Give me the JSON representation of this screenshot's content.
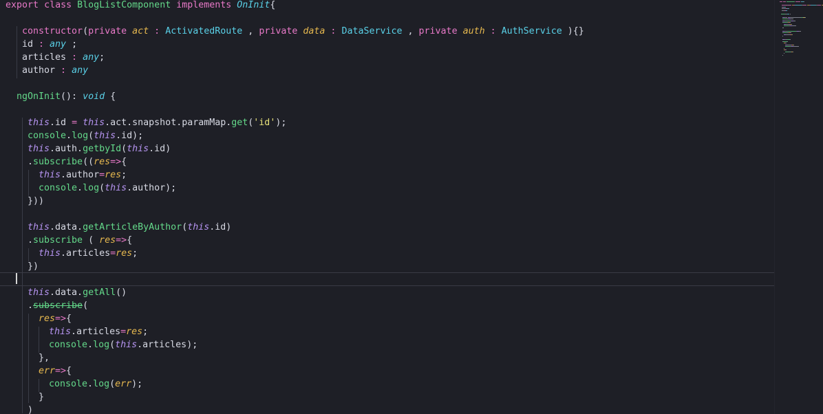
{
  "editor": {
    "lines": [
      {
        "indent": 8,
        "tokens": [
          [
            "export",
            "kw"
          ],
          [
            " ",
            "plain"
          ],
          [
            "class",
            "kw"
          ],
          [
            " ",
            "plain"
          ],
          [
            "BlogListComponent",
            "fn"
          ],
          [
            " ",
            "plain"
          ],
          [
            "implements",
            "kw"
          ],
          [
            " ",
            "plain"
          ],
          [
            "OnInit",
            "typei"
          ],
          [
            "{",
            "pun"
          ]
        ]
      },
      {
        "indent": 8,
        "tokens": []
      },
      {
        "indent": 32,
        "tokens": [
          [
            "constructor",
            "kw"
          ],
          [
            "(",
            "pun"
          ],
          [
            "private",
            "kw"
          ],
          [
            " ",
            "plain"
          ],
          [
            "act",
            "var"
          ],
          [
            " : ",
            "op"
          ],
          [
            "ActivatedRoute",
            "type"
          ],
          [
            " , ",
            "pun"
          ],
          [
            "private",
            "kw"
          ],
          [
            " ",
            "plain"
          ],
          [
            "data",
            "var"
          ],
          [
            " : ",
            "op"
          ],
          [
            "DataService",
            "type"
          ],
          [
            " , ",
            "pun"
          ],
          [
            "private",
            "kw"
          ],
          [
            " ",
            "plain"
          ],
          [
            "auth",
            "var"
          ],
          [
            " : ",
            "op"
          ],
          [
            "AuthService",
            "type"
          ],
          [
            " ){}",
            "pun"
          ]
        ]
      },
      {
        "indent": 32,
        "tokens": [
          [
            "id",
            "plain"
          ],
          [
            " : ",
            "op"
          ],
          [
            "any",
            "typei"
          ],
          [
            " ;",
            "pun"
          ]
        ]
      },
      {
        "indent": 32,
        "tokens": [
          [
            "articles",
            "plain"
          ],
          [
            " : ",
            "op"
          ],
          [
            "any",
            "typei"
          ],
          [
            ";",
            "pun"
          ]
        ]
      },
      {
        "indent": 32,
        "tokens": [
          [
            "author",
            "plain"
          ],
          [
            " : ",
            "op"
          ],
          [
            "any",
            "typei"
          ]
        ]
      },
      {
        "indent": 32,
        "tokens": []
      },
      {
        "indent": 24,
        "tokens": [
          [
            "ngOnInit",
            "fn"
          ],
          [
            "(): ",
            "pun"
          ],
          [
            "void",
            "typei"
          ],
          [
            " ",
            "plain"
          ],
          [
            "{",
            "brk"
          ]
        ]
      },
      {
        "indent": 24,
        "tokens": []
      },
      {
        "indent": 40,
        "tokens": [
          [
            "this",
            "this"
          ],
          [
            ".id ",
            "plain"
          ],
          [
            "=",
            "op"
          ],
          [
            " ",
            "plain"
          ],
          [
            "this",
            "this"
          ],
          [
            ".act.snapshot.paramMap.",
            "plain"
          ],
          [
            "get",
            "fn"
          ],
          [
            "(",
            "pun"
          ],
          [
            "'id'",
            "str"
          ],
          [
            ");",
            "pun"
          ]
        ]
      },
      {
        "indent": 40,
        "tokens": [
          [
            "console",
            "fn"
          ],
          [
            ".",
            "plain"
          ],
          [
            "log",
            "fn"
          ],
          [
            "(",
            "pun"
          ],
          [
            "this",
            "this"
          ],
          [
            ".id);",
            "plain"
          ]
        ]
      },
      {
        "indent": 40,
        "tokens": [
          [
            "this",
            "this"
          ],
          [
            ".auth.",
            "plain"
          ],
          [
            "getbyId",
            "fn"
          ],
          [
            "(",
            "pun"
          ],
          [
            "this",
            "this"
          ],
          [
            ".id)",
            "plain"
          ]
        ]
      },
      {
        "indent": 40,
        "tokens": [
          [
            ".",
            "plain"
          ],
          [
            "subscribe",
            "fn"
          ],
          [
            "((",
            "pun"
          ],
          [
            "res",
            "var"
          ],
          [
            "=>",
            "op"
          ],
          [
            "{",
            "pun"
          ]
        ]
      },
      {
        "indent": 56,
        "tokens": [
          [
            "this",
            "this"
          ],
          [
            ".author",
            "plain"
          ],
          [
            "=",
            "op"
          ],
          [
            "res",
            "var"
          ],
          [
            ";",
            "pun"
          ]
        ]
      },
      {
        "indent": 56,
        "tokens": [
          [
            "console",
            "fn"
          ],
          [
            ".",
            "plain"
          ],
          [
            "log",
            "fn"
          ],
          [
            "(",
            "pun"
          ],
          [
            "this",
            "this"
          ],
          [
            ".author);",
            "plain"
          ]
        ]
      },
      {
        "indent": 40,
        "tokens": [
          [
            "}))",
            "pun"
          ]
        ]
      },
      {
        "indent": 40,
        "tokens": []
      },
      {
        "indent": 40,
        "tokens": [
          [
            "this",
            "this"
          ],
          [
            ".data.",
            "plain"
          ],
          [
            "getArticleByAuthor",
            "fn"
          ],
          [
            "(",
            "pun"
          ],
          [
            "this",
            "this"
          ],
          [
            ".id)",
            "plain"
          ]
        ]
      },
      {
        "indent": 40,
        "tokens": [
          [
            ".",
            "plain"
          ],
          [
            "subscribe",
            "fn"
          ],
          [
            " ( ",
            "pun"
          ],
          [
            "res",
            "var"
          ],
          [
            "=>",
            "op"
          ],
          [
            "{",
            "pun"
          ]
        ]
      },
      {
        "indent": 56,
        "tokens": [
          [
            "this",
            "this"
          ],
          [
            ".articles",
            "plain"
          ],
          [
            "=",
            "op"
          ],
          [
            "res",
            "var"
          ],
          [
            ";",
            "pun"
          ]
        ]
      },
      {
        "indent": 40,
        "tokens": [
          [
            "})",
            "pun"
          ]
        ]
      },
      {
        "indent": 40,
        "tokens": []
      },
      {
        "indent": 40,
        "tokens": [
          [
            "this",
            "this"
          ],
          [
            ".data.",
            "plain"
          ],
          [
            "getAll",
            "fn"
          ],
          [
            "()",
            "pun"
          ]
        ]
      },
      {
        "indent": 40,
        "tokens": [
          [
            ".",
            "plain"
          ],
          [
            "subscribe",
            "strike"
          ],
          [
            "(",
            "pun"
          ]
        ]
      },
      {
        "indent": 56,
        "tokens": [
          [
            "res",
            "var"
          ],
          [
            "=>",
            "op"
          ],
          [
            "{",
            "pun"
          ]
        ]
      },
      {
        "indent": 71,
        "tokens": [
          [
            "this",
            "this"
          ],
          [
            ".articles",
            "plain"
          ],
          [
            "=",
            "op"
          ],
          [
            "res",
            "var"
          ],
          [
            ";",
            "pun"
          ]
        ]
      },
      {
        "indent": 71,
        "tokens": [
          [
            "console",
            "fn"
          ],
          [
            ".",
            "plain"
          ],
          [
            "log",
            "fn"
          ],
          [
            "(",
            "pun"
          ],
          [
            "this",
            "this"
          ],
          [
            ".articles);",
            "plain"
          ]
        ]
      },
      {
        "indent": 56,
        "tokens": [
          [
            "},",
            "pun"
          ]
        ]
      },
      {
        "indent": 56,
        "tokens": [
          [
            "err",
            "var"
          ],
          [
            "=>",
            "op"
          ],
          [
            "{",
            "pun"
          ]
        ]
      },
      {
        "indent": 71,
        "tokens": [
          [
            "console",
            "fn"
          ],
          [
            ".",
            "plain"
          ],
          [
            "log",
            "fn"
          ],
          [
            "(",
            "pun"
          ],
          [
            "err",
            "var"
          ],
          [
            ");",
            "pun"
          ]
        ]
      },
      {
        "indent": 56,
        "tokens": [
          [
            "}",
            "pun"
          ]
        ]
      },
      {
        "indent": 40,
        "tokens": [
          [
            ")",
            "pun"
          ]
        ]
      }
    ],
    "colors": {
      "background": "#1e1f26",
      "keyword": "#e879c8",
      "variable": "#e6b84f",
      "type": "#5ad1e8",
      "function": "#64d98a",
      "this": "#b795f2",
      "string": "#e8e27a",
      "text": "#d8dae4"
    }
  }
}
